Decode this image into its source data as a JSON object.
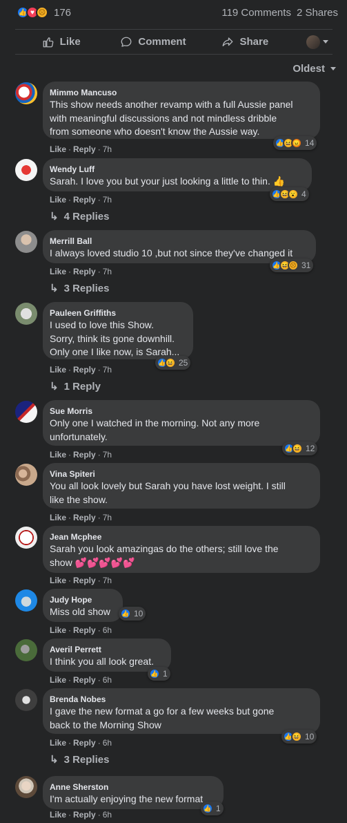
{
  "post_stats": {
    "reaction_count": "176",
    "comments": "119 Comments",
    "shares": "2 Shares",
    "reaction_icons": [
      "like",
      "love",
      "sad"
    ]
  },
  "actions": {
    "like": "Like",
    "comment": "Comment",
    "share": "Share"
  },
  "sort": {
    "label": "Oldest"
  },
  "comments": [
    {
      "author": "Mimmo Mancuso",
      "lines": [
        "This show needs another revamp with a full Aussie panel",
        "with meaningful discussions and not mindless dribble",
        "from someone who doesn't know the Aussie way."
      ],
      "like": "Like",
      "reply": "Reply",
      "time": "7h",
      "reaction_count": "14",
      "reactions": [
        "like",
        "haha",
        "angry"
      ],
      "replies": ""
    },
    {
      "author": "Wendy Luff",
      "lines": [
        "Sarah. I love you but your just looking a little to thin. 👍"
      ],
      "like": "Like",
      "reply": "Reply",
      "time": "7h",
      "reaction_count": "4",
      "reactions": [
        "like",
        "haha",
        "wow"
      ],
      "replies": "4 Replies"
    },
    {
      "author": "Merrill Ball",
      "lines": [
        "I always loved studio 10 ,but not since they've changed it"
      ],
      "like": "Like",
      "reply": "Reply",
      "time": "7h",
      "reaction_count": "31",
      "reactions": [
        "like",
        "haha",
        "sad"
      ],
      "replies": "3 Replies"
    },
    {
      "author": "Pauleen Griffiths",
      "lines": [
        "I used to love this Show.",
        "Sorry, think its gone downhill.",
        "Only one I like now, is Sarah..."
      ],
      "like": "Like",
      "reply": "Reply",
      "time": "7h",
      "reaction_count": "25",
      "reactions": [
        "like",
        "haha"
      ],
      "replies": "1 Reply"
    },
    {
      "author": "Sue Morris",
      "lines": [
        "Only one I watched in the morning. Not any more",
        "unfortunately."
      ],
      "like": "Like",
      "reply": "Reply",
      "time": "7h",
      "reaction_count": "12",
      "reactions": [
        "like",
        "haha"
      ],
      "replies": ""
    },
    {
      "author": "Vina Spiteri",
      "lines": [
        "You all look lovely but Sarah you have lost weight. I still",
        "like the show."
      ],
      "like": "Like",
      "reply": "Reply",
      "time": "7h",
      "reaction_count": "",
      "reactions": [],
      "replies": ""
    },
    {
      "author": "Jean Mcphee",
      "lines": [
        "Sarah you look amazingas do the others; still love the",
        "show 💕💕💕💕💕"
      ],
      "like": "Like",
      "reply": "Reply",
      "time": "7h",
      "reaction_count": "",
      "reactions": [],
      "replies": ""
    },
    {
      "author": "Judy Hope",
      "lines": [
        "Miss old show"
      ],
      "like": "Like",
      "reply": "Reply",
      "time": "6h",
      "reaction_count": "10",
      "reactions": [
        "like"
      ],
      "replies": ""
    },
    {
      "author": "Averil Perrett",
      "lines": [
        "I think you all look great."
      ],
      "like": "Like",
      "reply": "Reply",
      "time": "6h",
      "reaction_count": "1",
      "reactions": [
        "like"
      ],
      "replies": ""
    },
    {
      "author": "Brenda Nobes",
      "lines": [
        "I gave the new format a go for a few weeks but gone",
        "back to the Morning Show"
      ],
      "like": "Like",
      "reply": "Reply",
      "time": "6h",
      "reaction_count": "10",
      "reactions": [
        "like",
        "haha"
      ],
      "replies": "3 Replies"
    },
    {
      "author": "Anne Sherston",
      "lines": [
        "I'm actually enjoying the new format"
      ],
      "like": "Like",
      "reply": "Reply",
      "time": "6h",
      "reaction_count": "1",
      "reactions": [
        "like"
      ],
      "replies": ""
    }
  ],
  "colors": {
    "background": "#242526",
    "bubble": "#3a3b3c",
    "text": "#e4e6eb",
    "secondary": "#b0b3b8",
    "like_blue": "#1877f2"
  }
}
